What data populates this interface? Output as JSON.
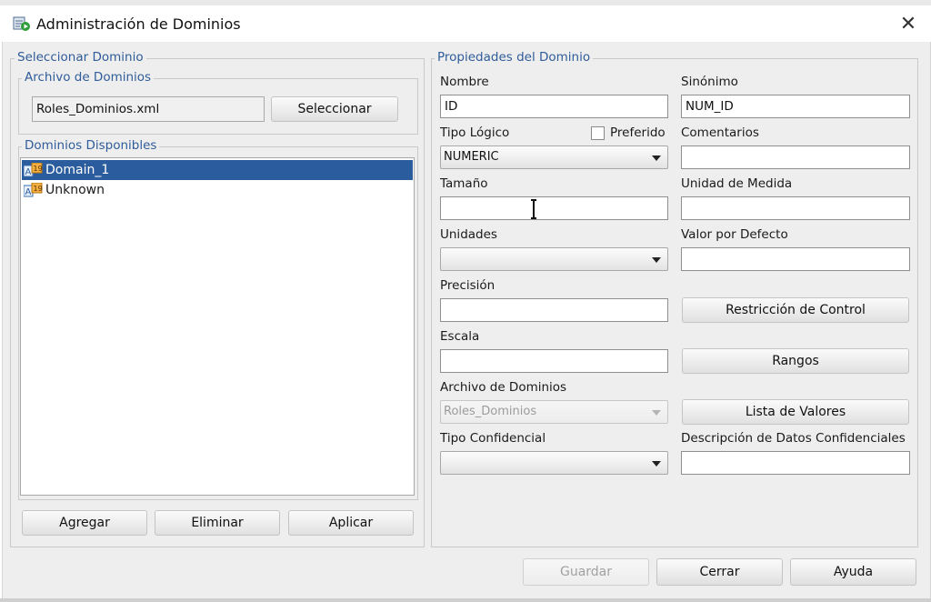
{
  "window": {
    "title": "Administración de Dominios",
    "icon": "domain-admin-icon",
    "close_icon": "close-icon"
  },
  "select_domain": {
    "legend": "Seleccionar Dominio",
    "file_group": {
      "legend": "Archivo de Dominios",
      "file_value": "Roles_Dominios.xml",
      "select_button": "Seleccionar"
    },
    "available": {
      "legend": "Dominios Disponibles",
      "items": [
        {
          "label": "Domain_1",
          "selected": true,
          "icon": "domain-icon"
        },
        {
          "label": "Unknown",
          "selected": false,
          "icon": "domain-icon"
        }
      ]
    },
    "buttons": {
      "add": "Agregar",
      "delete": "Eliminar",
      "apply": "Aplicar"
    }
  },
  "properties": {
    "legend": "Propiedades del Dominio",
    "name": {
      "label": "Nombre",
      "value": "ID"
    },
    "synonym": {
      "label": "Sinónimo",
      "value": "NUM_ID"
    },
    "logical_type": {
      "label": "Tipo Lógico",
      "value": "NUMERIC"
    },
    "preferred": {
      "label": "Preferido",
      "checked": false
    },
    "comments": {
      "label": "Comentarios",
      "value": ""
    },
    "size": {
      "label": "Tamaño",
      "value": ""
    },
    "unit_of_measure": {
      "label": "Unidad de Medida",
      "value": ""
    },
    "units": {
      "label": "Unidades",
      "value": ""
    },
    "default_value": {
      "label": "Valor por Defecto",
      "value": ""
    },
    "precision": {
      "label": "Precisión",
      "value": ""
    },
    "check_constraint_button": "Restricción de Control",
    "scale": {
      "label": "Escala",
      "value": ""
    },
    "ranges_button": "Rangos",
    "domain_file": {
      "label": "Archivo de Dominios",
      "value": "Roles_Dominios"
    },
    "value_list_button": "Lista de Valores",
    "sensitive_type": {
      "label": "Tipo Confidencial",
      "value": ""
    },
    "sensitive_desc": {
      "label": "Descripción de Datos Confidenciales",
      "value": ""
    }
  },
  "footer": {
    "save": "Guardar",
    "close": "Cerrar",
    "help": "Ayuda"
  },
  "colors": {
    "accent_legend": "#2f5c9a",
    "selection": "#2b5c9e",
    "background": "#eeeeee"
  }
}
